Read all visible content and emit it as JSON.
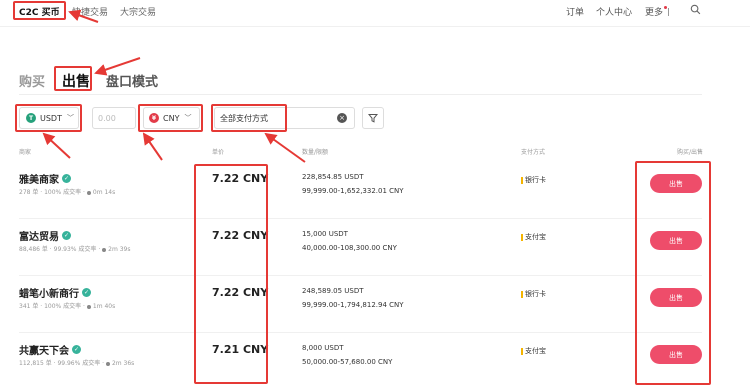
{
  "nav": {
    "tabs": [
      "C2C 买币",
      "快捷交易",
      "大宗交易"
    ],
    "right": [
      "订单",
      "个人中心",
      "更多"
    ]
  },
  "modes": [
    "购买",
    "出售",
    "盘口模式"
  ],
  "filters": {
    "coin": "USDT",
    "amount_placeholder": "0.00",
    "fiat": "CNY",
    "payment": "全部支付方式"
  },
  "columns": [
    "商家",
    "单价",
    "数量/限额",
    "支付方式",
    "购买/出售"
  ],
  "rows": [
    {
      "name": "雅美商家",
      "stats": "278 单 · 100% 成交率 ·",
      "time": "0m 14s",
      "price": "7.22 CNY",
      "available": "228,854.85 USDT",
      "limit": "99,999.00-1,652,332.01 CNY",
      "payment": "银行卡",
      "action": "出售"
    },
    {
      "name": "富达贸易",
      "stats": "88,486 单 · 99.93% 成交率 ·",
      "time": "2m 39s",
      "price": "7.22 CNY",
      "available": "15,000 USDT",
      "limit": "40,000.00-108,300.00 CNY",
      "payment": "支付宝",
      "action": "出售"
    },
    {
      "name": "蜡笔小新商行",
      "stats": "341 单 · 100% 成交率 ·",
      "time": "1m 40s",
      "price": "7.22 CNY",
      "available": "248,589.05 USDT",
      "limit": "99,999.00-1,794,812.94 CNY",
      "payment": "银行卡",
      "action": "出售"
    },
    {
      "name": "共赢天下会",
      "stats": "112,815 单 · 99.96% 成交率 ·",
      "time": "2m 36s",
      "price": "7.21 CNY",
      "available": "8,000 USDT",
      "limit": "50,000.00-57,680.00 CNY",
      "payment": "支付宝",
      "action": "出售"
    }
  ],
  "colors": {
    "accent": "#e23b49",
    "annotation": "#e53935",
    "sell_button": "#ee4d6a"
  },
  "icons": [
    "search-icon",
    "usdt-coin-icon",
    "cny-coin-icon",
    "clear-icon",
    "filter-icon",
    "verified-icon",
    "chevron-down-icon"
  ]
}
